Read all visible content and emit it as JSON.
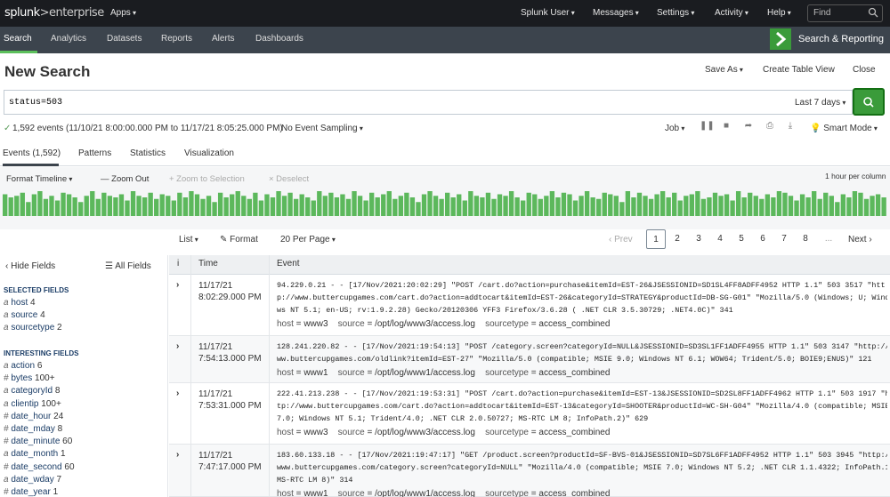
{
  "topbar": {
    "logo_main": "splunk",
    "logo_sub": ">enterprise",
    "apps": "Apps",
    "user": "Splunk User",
    "messages": "Messages",
    "settings": "Settings",
    "activity": "Activity",
    "help": "Help",
    "find_placeholder": "Find"
  },
  "appbar": {
    "nav": [
      "Search",
      "Analytics",
      "Datasets",
      "Reports",
      "Alerts",
      "Dashboards"
    ],
    "app_name": "Search & Reporting",
    "accent": "#5cc05c"
  },
  "page": {
    "title": "New Search",
    "save_as": "Save As",
    "create_table": "Create Table View",
    "close": "Close"
  },
  "search": {
    "query": "status=503",
    "time_range": "Last 7 days"
  },
  "status": {
    "check": "✓",
    "summary": "1,592 events (11/10/21 8:00:00.000 PM to 11/17/21 8:05:25.000 PM)",
    "sampling": "No Event Sampling",
    "job": "Job",
    "mode": "Smart Mode"
  },
  "tabs": [
    "Events (1,592)",
    "Patterns",
    "Statistics",
    "Visualization"
  ],
  "timeline": {
    "format": "Format Timeline",
    "zoom_out": "— Zoom Out",
    "zoom_sel": "+ Zoom to Selection",
    "deselect": "× Deselect",
    "per_column": "1 hour per column",
    "values": [
      14,
      12,
      13,
      15,
      9,
      14,
      16,
      11,
      13,
      10,
      15,
      14,
      12,
      9,
      13,
      16,
      11,
      15,
      13,
      12,
      14,
      10,
      16,
      13,
      12,
      15,
      11,
      14,
      13,
      10,
      15,
      12,
      16,
      14,
      11,
      13,
      9,
      15,
      12,
      14,
      16,
      13,
      11,
      15,
      10,
      14,
      12,
      16,
      13,
      15,
      11,
      14,
      12,
      10,
      16,
      13,
      15,
      12,
      14,
      11,
      16,
      13,
      10,
      15,
      12,
      14,
      16,
      11,
      13,
      15,
      12,
      9,
      14,
      16,
      13,
      11,
      15,
      12,
      14,
      10,
      16,
      13,
      12,
      15,
      11,
      14,
      13,
      16,
      12,
      10,
      15,
      14,
      11,
      13,
      16,
      12,
      15,
      14,
      10,
      13,
      16,
      12,
      11,
      15,
      14,
      13,
      9,
      16,
      12,
      15,
      13,
      11,
      14,
      16,
      12,
      15,
      10,
      13,
      14,
      16,
      11,
      12,
      15,
      13,
      14,
      10,
      16,
      12,
      15,
      13,
      11,
      14,
      12,
      16,
      15,
      13,
      10,
      14,
      12,
      16,
      11,
      15,
      13,
      9,
      14,
      12,
      16,
      15,
      11,
      13,
      14,
      12
    ]
  },
  "pager": {
    "list": "List",
    "format": "Format",
    "per_page": "20 Per Page",
    "prev": "‹ Prev",
    "pages": [
      "1",
      "2",
      "3",
      "4",
      "5",
      "6",
      "7",
      "8"
    ],
    "ellipsis": "...",
    "next": "Next ›"
  },
  "fields": {
    "hide": "‹ Hide Fields",
    "all": "☰ All Fields",
    "selected_head": "SELECTED FIELDS",
    "selected": [
      {
        "t": "a",
        "n": "host",
        "c": "4"
      },
      {
        "t": "a",
        "n": "source",
        "c": "4"
      },
      {
        "t": "a",
        "n": "sourcetype",
        "c": "2"
      }
    ],
    "interesting_head": "INTERESTING FIELDS",
    "interesting": [
      {
        "t": "a",
        "n": "action",
        "c": "6"
      },
      {
        "t": "#",
        "n": "bytes",
        "c": "100+"
      },
      {
        "t": "a",
        "n": "categoryId",
        "c": "8"
      },
      {
        "t": "a",
        "n": "clientip",
        "c": "100+"
      },
      {
        "t": "#",
        "n": "date_hour",
        "c": "24"
      },
      {
        "t": "#",
        "n": "date_mday",
        "c": "8"
      },
      {
        "t": "#",
        "n": "date_minute",
        "c": "60"
      },
      {
        "t": "a",
        "n": "date_month",
        "c": "1"
      },
      {
        "t": "#",
        "n": "date_second",
        "c": "60"
      },
      {
        "t": "a",
        "n": "date_wday",
        "c": "7"
      },
      {
        "t": "#",
        "n": "date_year",
        "c": "1"
      }
    ]
  },
  "results": {
    "col_i": "i",
    "col_time": "Time",
    "col_event": "Event",
    "rows": [
      {
        "date": "11/17/21",
        "time": "8:02:29.000 PM",
        "l1": "94.229.0.21 - - [17/Nov/2021:20:02:29] \"POST /cart.do?action=purchase&itemId=EST-26&JSESSIONID=SD1SL4FF8ADFF4952 HTTP 1.1\" 503 3517 \"htt",
        "l2": "p://www.buttercupgames.com/cart.do?action=addtocart&itemId=EST-26&categoryId=STRATEGY&productId=DB-SG-G01\" \"Mozilla/5.0 (Windows; U; Windo",
        "l3": "ws NT 5.1; en-US; rv:1.9.2.28) Gecko/20120306 YFF3 Firefox/3.6.28 ( .NET CLR 3.5.30729; .NET4.0C)\" 341",
        "host": "www3",
        "source": "/opt/log/www3/access.log",
        "sourcetype": "access_combined"
      },
      {
        "date": "11/17/21",
        "time": "7:54:13.000 PM",
        "l1": "128.241.220.82 - - [17/Nov/2021:19:54:13] \"POST /category.screen?categoryId=NULL&JSESSIONID=SD3SL1FF1ADFF4955 HTTP 1.1\" 503 3147 \"http://w",
        "l2": "ww.buttercupgames.com/oldlink?itemId=EST-27\" \"Mozilla/5.0 (compatible; MSIE 9.0; Windows NT 6.1; WOW64; Trident/5.0; BOIE9;ENUS)\" 121",
        "l3": "",
        "host": "www1",
        "source": "/opt/log/www1/access.log",
        "sourcetype": "access_combined"
      },
      {
        "date": "11/17/21",
        "time": "7:53:31.000 PM",
        "l1": "222.41.213.238 - - [17/Nov/2021:19:53:31] \"POST /cart.do?action=purchase&itemId=EST-13&JSESSIONID=SD2SL8FF1ADFF4962 HTTP 1.1\" 503 1917 \"ht",
        "l2": "tp://www.buttercupgames.com/cart.do?action=addtocart&itemId=EST-13&categoryId=SHOOTER&productId=WC-SH-G04\" \"Mozilla/4.0 (compatible; MSIE",
        "l3": "7.0; Windows NT 5.1; Trident/4.0; .NET CLR 2.0.50727; MS-RTC LM 8; InfoPath.2)\" 629",
        "host": "www3",
        "source": "/opt/log/www3/access.log",
        "sourcetype": "access_combined"
      },
      {
        "date": "11/17/21",
        "time": "7:47:17.000 PM",
        "l1": "183.60.133.18 - - [17/Nov/2021:19:47:17] \"GET /product.screen?productId=SF-BVS-01&JSESSIONID=SD7SL6FF1ADFF4952 HTTP 1.1\" 503 3945 \"http://",
        "l2": "www.buttercupgames.com/category.screen?categoryId=NULL\" \"Mozilla/4.0 (compatible; MSIE 7.0; Windows NT 5.2; .NET CLR 1.1.4322; InfoPath.1;",
        "l3": "MS-RTC LM 8)\" 314",
        "host": "www1",
        "source": "/opt/log/www1/access.log",
        "sourcetype": "access_combined"
      }
    ]
  }
}
